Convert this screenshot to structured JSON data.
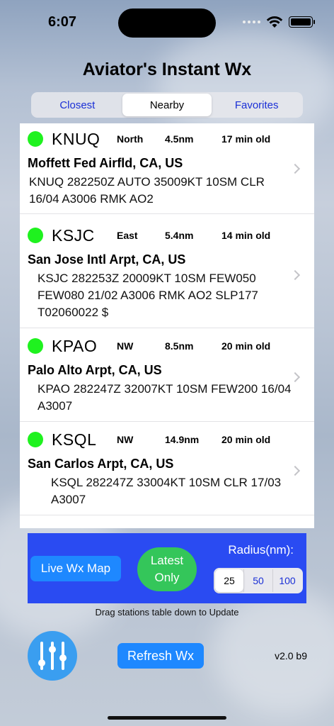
{
  "status_bar": {
    "time": "6:07"
  },
  "app": {
    "title": "Aviator's Instant Wx"
  },
  "tabs": [
    {
      "label": "Closest",
      "active": false
    },
    {
      "label": "Nearby",
      "active": true
    },
    {
      "label": "Favorites",
      "active": false
    }
  ],
  "stations": [
    {
      "ident": "KNUQ",
      "direction": "North",
      "distance": "4.5nm",
      "age": "17 min old",
      "name": "Moffett Fed Airfld, CA, US",
      "metar": "KNUQ 282250Z AUTO 35009KT 10SM CLR 16/04 A3006 RMK AO2",
      "status_color": "#1ff21f"
    },
    {
      "ident": "KSJC",
      "direction": "East",
      "distance": "5.4nm",
      "age": "14 min old",
      "name": "San Jose Intl Arpt, CA, US",
      "metar": "KSJC 282253Z 20009KT 10SM FEW050 FEW080 21/02 A3006 RMK AO2 SLP177 T02060022 $",
      "status_color": "#1ff21f"
    },
    {
      "ident": "KPAO",
      "direction": "NW",
      "distance": "8.5nm",
      "age": "20 min old",
      "name": "Palo Alto Arpt, CA, US",
      "metar": "KPAO 282247Z 32007KT 10SM FEW200 16/04 A3007",
      "status_color": "#1ff21f"
    },
    {
      "ident": "KSQL",
      "direction": "NW",
      "distance": "14.9nm",
      "age": "20 min old",
      "name": "San Carlos Arpt, CA, US",
      "metar": "KSQL 282247Z 33004KT 10SM CLR 17/03 A3007",
      "status_color": "#1ff21f"
    }
  ],
  "controls": {
    "live_map_label": "Live Wx Map",
    "latest_line1": "Latest",
    "latest_line2": "Only",
    "radius_label": "Radius(nm):",
    "radius_options": [
      {
        "label": "25",
        "active": true
      },
      {
        "label": "50",
        "active": false
      },
      {
        "label": "100",
        "active": false
      }
    ]
  },
  "footer": {
    "drag_hint": "Drag stations table down to Update",
    "refresh_label": "Refresh Wx",
    "version": "v2.0 b9",
    "settings_icon": "sliders-icon"
  },
  "colors": {
    "panel": "#2a4bf2",
    "button_blue": "#1e88ff",
    "latest_green": "#34c65a",
    "status_green": "#1ff21f"
  }
}
